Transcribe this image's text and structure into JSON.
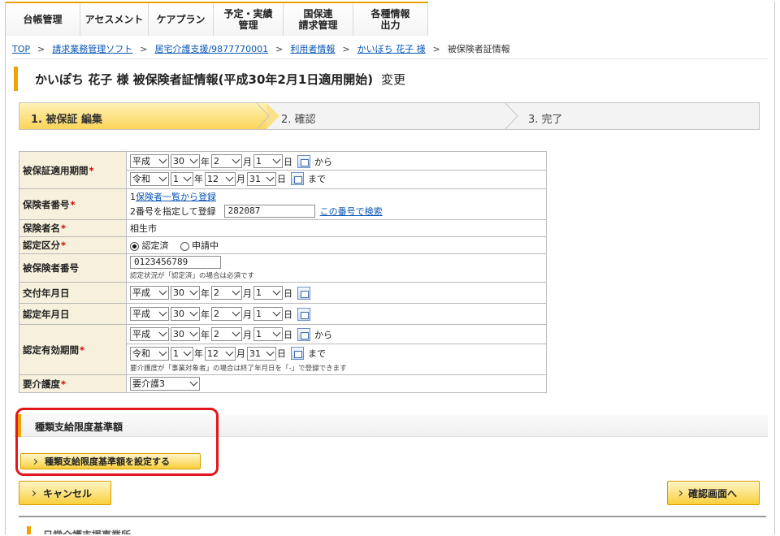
{
  "nav": [
    "台帳管理",
    "アセスメント",
    "ケアプラン",
    "予定・実績\n管理",
    "国保連\n請求管理",
    "各種情報\n出力"
  ],
  "breadcrumb": {
    "items": [
      "TOP",
      "請求業務管理ソフト",
      "居宅介護支援/9877770001",
      "利用者情報",
      "かいぼち 花子 様"
    ],
    "current": "被保険者証情報",
    "separator": ">"
  },
  "title": {
    "main": "かいぽち 花子 様 被保険者証情報(平成30年2月1日適用開始)",
    "action": "変更"
  },
  "steps": [
    {
      "label": "1. 被保証 編集",
      "active": true
    },
    {
      "label": "2. 確認",
      "active": false
    },
    {
      "label": "3. 完了",
      "active": false
    }
  ],
  "form": {
    "validity_label": "被保証適用期間",
    "from_era": "平成",
    "from_year": "30",
    "from_month": "2",
    "from_day": "1",
    "from_suffix": "から",
    "to_era": "令和",
    "to_year": "1",
    "to_month": "12",
    "to_day": "31",
    "to_suffix": "まで",
    "unit_year": "年",
    "unit_month": "月",
    "unit_day": "日",
    "insurer_no_label": "保険者番号",
    "insurer_opt1_prefix": "1",
    "insurer_opt1_link": "保険者一覧から登録",
    "insurer_opt2": "2番号を指定して登録",
    "insurer_no_value": "282087",
    "insurer_search_link": "この番号で検索",
    "insurer_name_label": "保険者名",
    "insurer_name": "相生市",
    "cert_label": "認定区分",
    "cert_opt1": "認定済",
    "cert_opt2": "申請中",
    "insured_no_label": "被保険者番号",
    "insured_no_value": "0123456789",
    "insured_no_note": "認定状況が「認定済」の場合は必須です",
    "issue_label": "交付年月日",
    "issue_era": "平成",
    "issue_year": "30",
    "issue_month": "2",
    "issue_day": "1",
    "certdate_label": "認定年月日",
    "certdate_era": "平成",
    "certdate_year": "30",
    "certdate_month": "2",
    "certdate_day": "1",
    "certvalid_label": "認定有効期間",
    "cv_from_era": "平成",
    "cv_from_year": "30",
    "cv_from_month": "2",
    "cv_from_day": "1",
    "cv_from_suffix": "から",
    "cv_to_era": "令和",
    "cv_to_year": "1",
    "cv_to_month": "12",
    "cv_to_day": "31",
    "cv_to_suffix": "まで",
    "certvalid_note": "要介護度が「事業対象者」の場合は終了年月日を「-」で登録できます",
    "care_level_label": "要介護度",
    "care_level_value": "要介護3"
  },
  "section": {
    "title": "種類支給限度基準額",
    "set_button": "種類支給限度基準額を設定する"
  },
  "actions": {
    "cancel": "キャンセル",
    "confirm": "確認画面へ"
  },
  "next_section_title": "日常介護支援事業所",
  "colors": {
    "accent": "#f2a200",
    "link": "#0a56b5",
    "required": "#d40000",
    "highlight": "#e4161d"
  }
}
